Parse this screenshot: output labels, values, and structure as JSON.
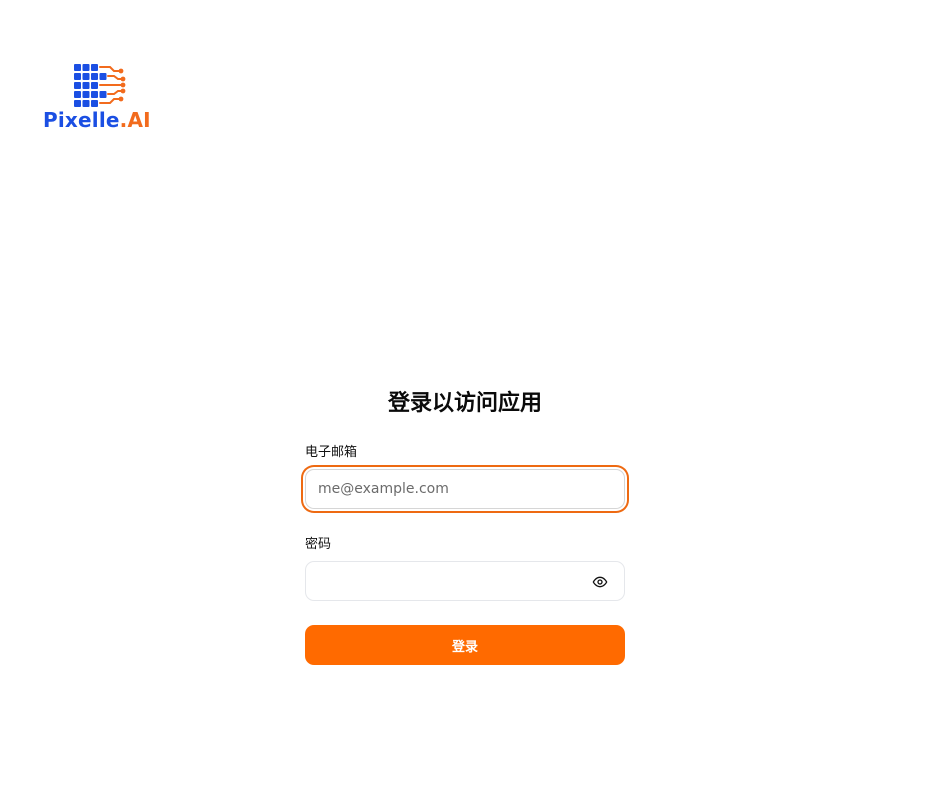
{
  "logo": {
    "text_part1": "Pixelle",
    "text_part2": ".AI",
    "colors": {
      "blue": "#1b4fe3",
      "orange": "#f26b1d"
    },
    "icon": "pixel-grid-circuit-icon"
  },
  "form": {
    "title": "登录以访问应用",
    "email": {
      "label": "电子邮箱",
      "placeholder": "me@example.com",
      "value": ""
    },
    "password": {
      "label": "密码",
      "value": "",
      "toggle_icon": "eye-icon"
    },
    "submit_label": "登录"
  },
  "colors": {
    "accent": "#ff6a00",
    "focus_ring": "#ee6a12"
  }
}
